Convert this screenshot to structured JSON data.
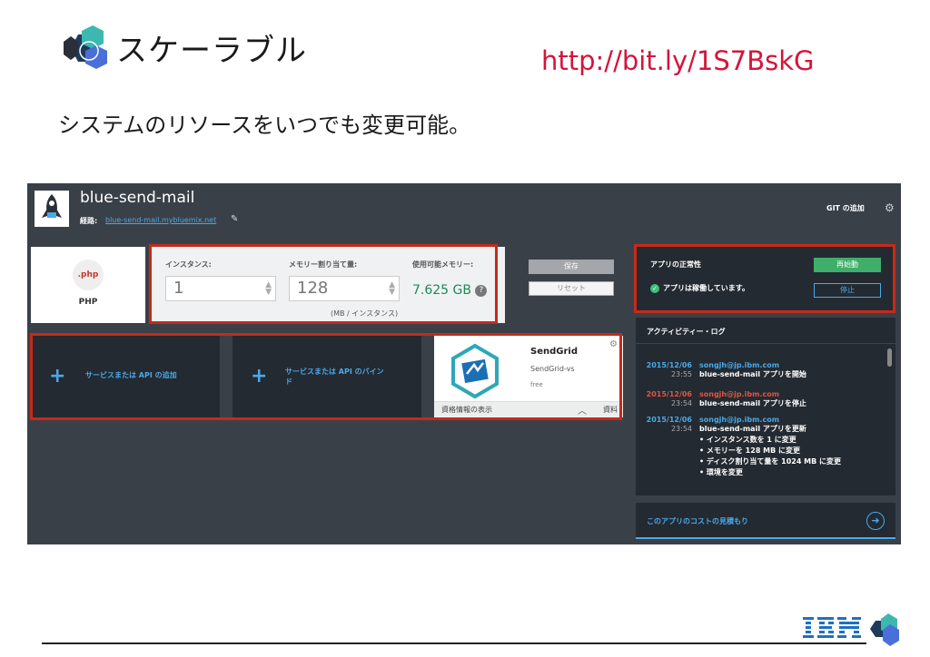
{
  "slide": {
    "title": "スケーラブル",
    "url": "http://bit.ly/1S7BskG",
    "subtitle": "システムのリソースをいつでも変更可能。"
  },
  "app": {
    "name": "blue-send-mail",
    "route_label": "経路:",
    "route_link": "blue-send-mail.mybluemix.net",
    "git_label": "GIT の追加"
  },
  "runtime": {
    "badge": ".php",
    "label": "PHP"
  },
  "config": {
    "instances_label": "インスタンス:",
    "instances_value": "1",
    "memory_label": "メモリー割り当て量:",
    "memory_value": "128",
    "avail_label": "使用可能メモリー:",
    "avail_value": "7.625 GB",
    "mb_note": "(MB / インスタンス)",
    "save": "保存",
    "reset": "リセット"
  },
  "services": {
    "add_service": "サービスまたは API の追加",
    "bind_line1": "サービスまたは API のバイン",
    "bind_line2": "ド",
    "sendgrid": {
      "name": "SendGrid",
      "instance": "SendGrid-vs",
      "plan": "free",
      "credentials": "資格情報の表示",
      "docs": "資料"
    }
  },
  "health": {
    "title": "アプリの正常性",
    "status": "アプリは稼働しています。",
    "restart": "再始動",
    "stop": "停止"
  },
  "activity": {
    "title": "アクティビティー・ログ",
    "entries": [
      {
        "date": "2015/12/06",
        "time": "23:55",
        "user": "songjh@jp.ibm.com",
        "msg": "blue-send-mail アプリを開始"
      },
      {
        "date": "2015/12/06",
        "time": "23:54",
        "user": "songjh@jp.ibm.com",
        "msg": "blue-send-mail アプリを停止"
      },
      {
        "date": "2015/12/06",
        "time": "23:54",
        "user": "songjh@jp.ibm.com",
        "msg": "blue-send-mail アプリを更新"
      }
    ],
    "bullets": [
      "• インスタンス数を 1 に変更",
      "• メモリーを 128 MB に変更",
      "• ディスク割り当て量を 1024 MB に変更",
      "• 環境を変更"
    ]
  },
  "cost": {
    "label": "このアプリのコストの見積もり"
  },
  "colors": {
    "accent": "#4aa8e8",
    "highlight": "#c62a1a",
    "url": "#d4153a",
    "ok": "#3fae6a"
  },
  "icons": [
    "bluemix-logo",
    "rocket-icon",
    "pencil-icon",
    "gear-icon",
    "help-icon",
    "check-icon",
    "plus-icon",
    "chevron-up-icon",
    "arrow-right-icon",
    "ibm-logo"
  ]
}
